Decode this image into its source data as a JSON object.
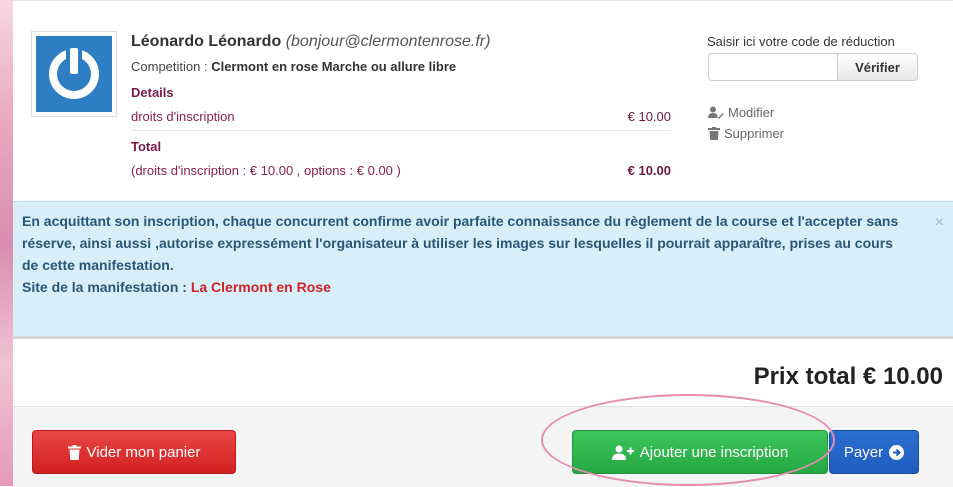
{
  "cart_item": {
    "participant_name": "Léonardo Léonardo",
    "participant_email": "(bonjour@clermontenrose.fr)",
    "competition_label": "Competition : ",
    "competition_value": "Clermont en rose Marche ou allure libre",
    "details_label": "Details",
    "fee_label": "droits d'inscription",
    "fee_amount": "€ 10.00",
    "total_label": "Total",
    "total_breakdown": "(droits d'inscription : € 10.00 , options : € 0.00 )",
    "total_amount": "€ 10.00"
  },
  "coupon": {
    "label": "Saisir ici votre code de réduction",
    "input_value": "",
    "button_label": "Vérifier"
  },
  "actions": {
    "modify": "Modifier",
    "delete": "Supprimer"
  },
  "notice": {
    "text": "En acquittant son inscription, chaque concurrent confirme avoir parfaite connaissance du règlement de la course et l'accepter sans réserve, ainsi aussi ,autorise expressément l'organisateur à utiliser les images sur lesquelles il pourrait apparaître, prises au cours de cette manifestation.",
    "site_label": "Site de la manifestation : ",
    "site_link": "La Clermont en Rose",
    "close": "×"
  },
  "summary": {
    "total_price": "Prix total € 10.00"
  },
  "footer": {
    "empty_cart": "Vider mon panier",
    "add_registration": "Ajouter une inscription",
    "pay": "Payer"
  },
  "colors": {
    "empty_cart": "#d9302f",
    "add_registration": "#2fb54d",
    "pay": "#2566c8",
    "notice_bg": "#d8eef8",
    "accent_maroon": "#7a1a4a"
  },
  "icons": {
    "avatar": "power-icon",
    "modify": "user-edit-icon",
    "delete": "trash-icon",
    "empty_cart": "trash-icon",
    "add_registration": "user-plus-icon",
    "pay": "arrow-circle-right-icon"
  }
}
